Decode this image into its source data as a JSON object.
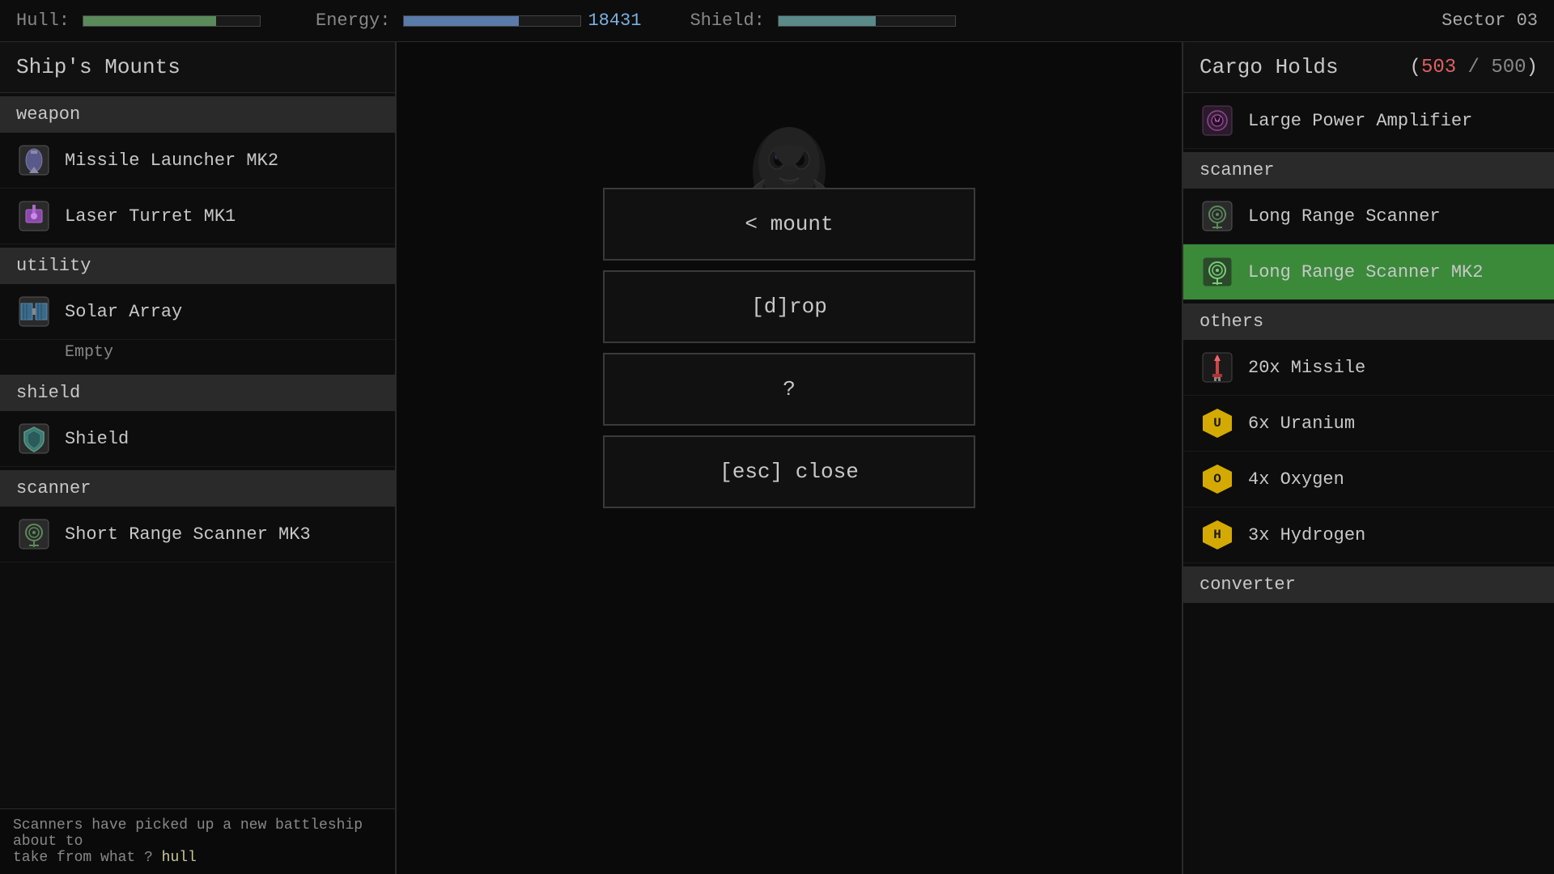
{
  "hud": {
    "hull_label": "Hull:",
    "hull_fill_pct": 75,
    "energy_label": "Energy:",
    "energy_value": "18431",
    "shield_label": "Shield:",
    "shield_fill_pct": 55,
    "sector_label": "Sector 03"
  },
  "left_panel": {
    "title": "Ship's Mounts",
    "categories": [
      {
        "name": "weapon",
        "items": [
          {
            "id": "missile-launcher",
            "label": "Missile Launcher MK2",
            "icon": "missile"
          },
          {
            "id": "laser-turret",
            "label": "Laser Turret MK1",
            "icon": "laser"
          }
        ]
      },
      {
        "name": "utility",
        "items": [
          {
            "id": "solar-array",
            "label": "Solar Array",
            "icon": "solar",
            "sublabel": "Empty"
          }
        ]
      },
      {
        "name": "shield",
        "items": [
          {
            "id": "shield",
            "label": "Shield",
            "icon": "shield"
          }
        ]
      },
      {
        "name": "scanner",
        "items": [
          {
            "id": "short-range-scanner",
            "label": "Short Range Scanner MK3",
            "icon": "scanner"
          }
        ]
      }
    ],
    "log_lines": [
      "Scanners have picked up a new battleship about to",
      "take from what ?"
    ],
    "log_highlight": "hull"
  },
  "center": {
    "mount_button_label": "< mount",
    "drop_button_label": "[d]rop",
    "help_button_label": "?",
    "close_button_label": "[esc] close"
  },
  "right_panel": {
    "title": "Cargo Holds",
    "cargo_current": "503",
    "cargo_max": "500",
    "categories": [
      {
        "name": "",
        "items": [
          {
            "id": "large-power-amplifier",
            "label": "Large Power Amplifier",
            "icon": "power"
          }
        ]
      },
      {
        "name": "scanner",
        "items": [
          {
            "id": "long-range-scanner",
            "label": "Long Range Scanner",
            "icon": "scanner-small"
          },
          {
            "id": "long-range-scanner-mk2",
            "label": "Long Range Scanner MK2",
            "icon": "scanner-green",
            "selected": true
          }
        ]
      },
      {
        "name": "others",
        "items": [
          {
            "id": "missile-20x",
            "label": "20x Missile",
            "icon": "missile-red"
          },
          {
            "id": "uranium-6x",
            "label": "6x Uranium",
            "icon": "uranium"
          },
          {
            "id": "oxygen-4x",
            "label": "4x Oxygen",
            "icon": "oxygen"
          },
          {
            "id": "hydrogen-3x",
            "label": "3x Hydrogen",
            "icon": "hydrogen"
          }
        ]
      },
      {
        "name": "converter",
        "items": []
      }
    ]
  }
}
